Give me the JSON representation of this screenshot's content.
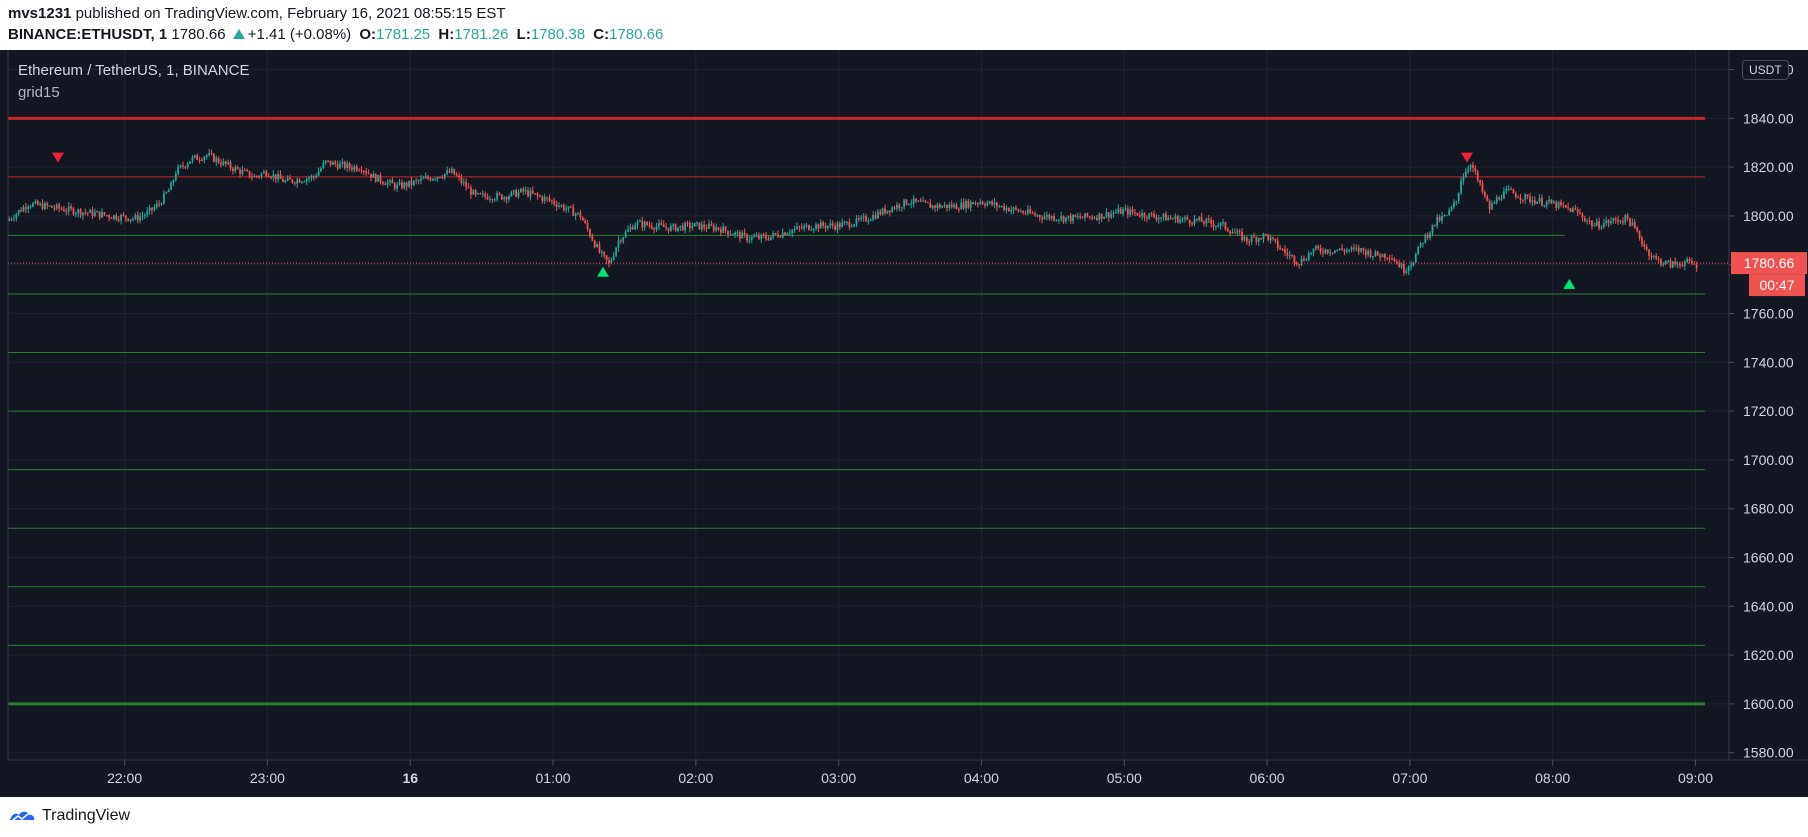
{
  "header": {
    "user": "mvs1231",
    "published_text": "published on TradingView.com, February 16, 2021 08:55:15 EST",
    "symbol": "BINANCE:ETHUSDT, 1",
    "last": "1780.66",
    "change": "+1.41 (+0.08%)",
    "open_label": "O:",
    "open": "1781.25",
    "high_label": "H:",
    "high": "1781.26",
    "low_label": "L:",
    "low": "1780.38",
    "close_label": "C:",
    "close": "1780.66"
  },
  "legend": {
    "title": "Ethereum / TetherUS, 1, BINANCE",
    "indicator": "grid15"
  },
  "currency": "USDT",
  "footer": {
    "brand": "TradingView",
    "logo_icon": "tradingview-logo-icon"
  },
  "colors": {
    "background": "#131722",
    "up": "#26a69a",
    "down": "#ef5350",
    "grid_green": "#2e7d32",
    "grid_red": "#c62828",
    "price_tag": "#ef5350"
  },
  "chart_data": {
    "type": "candlestick",
    "timeframe": "1",
    "x_ticks": [
      {
        "label": "22:00",
        "t": 0
      },
      {
        "label": "23:00",
        "t": 60
      },
      {
        "label": "16",
        "t": 120
      },
      {
        "label": "01:00",
        "t": 180
      },
      {
        "label": "02:00",
        "t": 240
      },
      {
        "label": "03:00",
        "t": 300
      },
      {
        "label": "04:00",
        "t": 360
      },
      {
        "label": "05:00",
        "t": 420
      },
      {
        "label": "06:00",
        "t": 480
      },
      {
        "label": "07:00",
        "t": 540
      },
      {
        "label": "08:00",
        "t": 600
      },
      {
        "label": "09:00",
        "t": 660
      }
    ],
    "x_range": [
      -49,
      664
    ],
    "y_ticks": [
      "1580.00",
      "1600.00",
      "1620.00",
      "1640.00",
      "1660.00",
      "1680.00",
      "1700.00",
      "1720.00",
      "1740.00",
      "1760.00",
      "1780.00",
      "1800.00",
      "1820.00",
      "1840.00",
      "1860.00"
    ],
    "ylim": [
      1577,
      1868
    ],
    "grid_lines": [
      {
        "price": 1840,
        "color": "red",
        "bold": true
      },
      {
        "price": 1816,
        "color": "red"
      },
      {
        "price": 1792,
        "color": "green",
        "x_end": 605
      },
      {
        "price": 1768,
        "color": "green"
      },
      {
        "price": 1744,
        "color": "green"
      },
      {
        "price": 1720,
        "color": "green"
      },
      {
        "price": 1696,
        "color": "green"
      },
      {
        "price": 1672,
        "color": "green"
      },
      {
        "price": 1648,
        "color": "green"
      },
      {
        "price": 1624,
        "color": "green"
      },
      {
        "price": 1600,
        "color": "green",
        "bold": true
      }
    ],
    "last_price": {
      "value": "1780.66",
      "countdown": "00:47"
    },
    "signals": [
      {
        "type": "sell",
        "t": -28,
        "price": 1821
      },
      {
        "type": "buy",
        "t": 201,
        "price": 1780
      },
      {
        "type": "sell",
        "t": 564,
        "price": 1821
      },
      {
        "type": "buy",
        "t": 607,
        "price": 1775
      }
    ],
    "price_path": [
      [
        -49,
        1798
      ],
      [
        -40,
        1805
      ],
      [
        -20,
        1802
      ],
      [
        -5,
        1800
      ],
      [
        5,
        1799
      ],
      [
        10,
        1801
      ],
      [
        15,
        1805
      ],
      [
        20,
        1812
      ],
      [
        22,
        1818
      ],
      [
        28,
        1823
      ],
      [
        35,
        1825
      ],
      [
        45,
        1820
      ],
      [
        55,
        1816
      ],
      [
        60,
        1818
      ],
      [
        68,
        1814
      ],
      [
        80,
        1816
      ],
      [
        85,
        1822
      ],
      [
        95,
        1820
      ],
      [
        100,
        1820
      ],
      [
        105,
        1816
      ],
      [
        115,
        1812
      ],
      [
        120,
        1813
      ],
      [
        130,
        1816
      ],
      [
        138,
        1818
      ],
      [
        148,
        1808
      ],
      [
        160,
        1808
      ],
      [
        168,
        1810
      ],
      [
        180,
        1806
      ],
      [
        192,
        1800
      ],
      [
        200,
        1785
      ],
      [
        204,
        1780
      ],
      [
        208,
        1790
      ],
      [
        215,
        1797
      ],
      [
        230,
        1795
      ],
      [
        240,
        1796
      ],
      [
        250,
        1795
      ],
      [
        262,
        1791
      ],
      [
        270,
        1791
      ],
      [
        280,
        1794
      ],
      [
        290,
        1796
      ],
      [
        300,
        1796
      ],
      [
        310,
        1798
      ],
      [
        322,
        1803
      ],
      [
        330,
        1806
      ],
      [
        340,
        1804
      ],
      [
        350,
        1804
      ],
      [
        360,
        1806
      ],
      [
        372,
        1803
      ],
      [
        385,
        1800
      ],
      [
        398,
        1799
      ],
      [
        410,
        1800
      ],
      [
        420,
        1802
      ],
      [
        432,
        1800
      ],
      [
        440,
        1799
      ],
      [
        452,
        1798
      ],
      [
        462,
        1796
      ],
      [
        472,
        1790
      ],
      [
        480,
        1792
      ],
      [
        488,
        1785
      ],
      [
        494,
        1781
      ],
      [
        500,
        1786
      ],
      [
        510,
        1786
      ],
      [
        520,
        1786
      ],
      [
        526,
        1784
      ],
      [
        532,
        1784
      ],
      [
        538,
        1778
      ],
      [
        542,
        1782
      ],
      [
        546,
        1790
      ],
      [
        552,
        1798
      ],
      [
        556,
        1800
      ],
      [
        560,
        1806
      ],
      [
        562,
        1815
      ],
      [
        566,
        1822
      ],
      [
        570,
        1812
      ],
      [
        574,
        1803
      ],
      [
        578,
        1808
      ],
      [
        582,
        1810
      ],
      [
        590,
        1807
      ],
      [
        600,
        1805
      ],
      [
        610,
        1802
      ],
      [
        618,
        1796
      ],
      [
        626,
        1798
      ],
      [
        632,
        1799
      ],
      [
        636,
        1793
      ],
      [
        640,
        1786
      ],
      [
        644,
        1782
      ],
      [
        650,
        1780
      ],
      [
        656,
        1781
      ],
      [
        660,
        1780
      ]
    ]
  }
}
